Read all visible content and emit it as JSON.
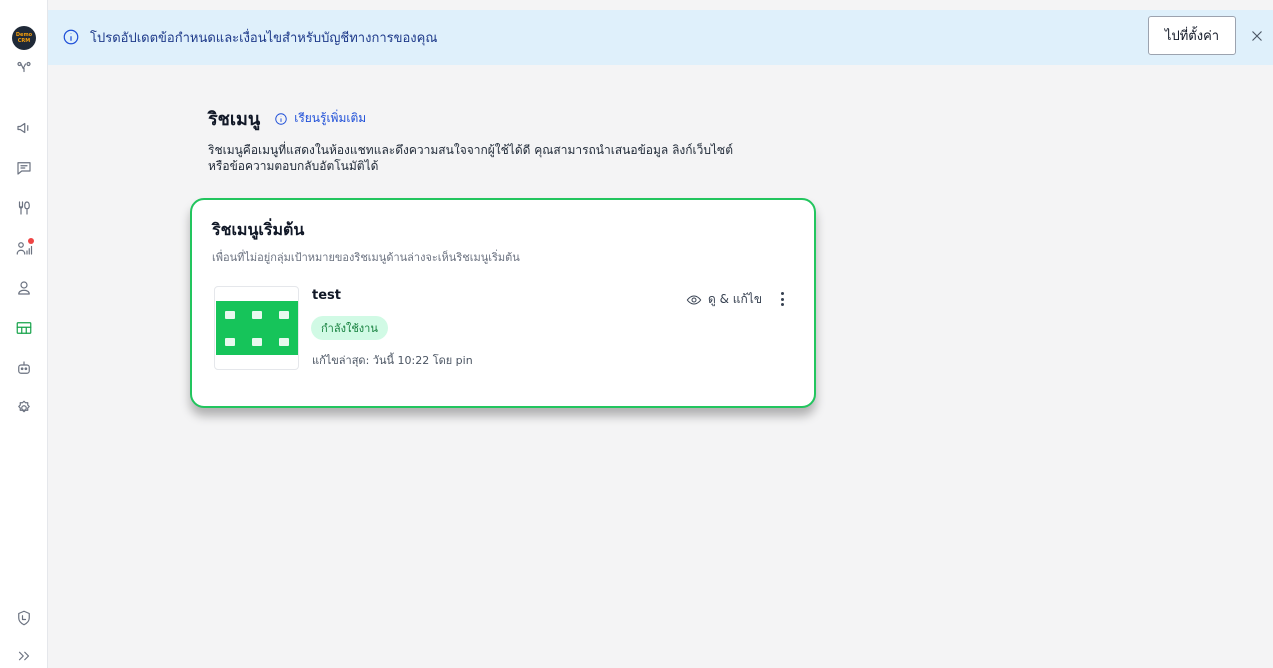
{
  "banner": {
    "message": "โปรดอัปเดตข้อกำหนดและเงื่อนไขสำหรับบัญชีทางการของคุณ",
    "button_label": "ไปที่ตั้งค่า"
  },
  "sidebar": {
    "logo_text_top": "Demo",
    "logo_text_bottom": "CRM",
    "items": [
      {
        "icon": "share-nodes-icon"
      },
      {
        "icon": "megaphone-icon"
      },
      {
        "icon": "chat-icon"
      },
      {
        "icon": "fork-spoon-icon"
      },
      {
        "icon": "user-stats-icon",
        "notification": true
      },
      {
        "icon": "user-icon"
      },
      {
        "icon": "rich-menu-icon",
        "active": true
      },
      {
        "icon": "bot-icon"
      },
      {
        "icon": "settings-icon"
      },
      {
        "icon": "shield-icon"
      },
      {
        "icon": "expand-icon"
      }
    ]
  },
  "page": {
    "title": "ริชเมนู",
    "learn_more": "เรียนรู้เพิ่มเติม",
    "description_line1": "ริชเมนูคือเมนูที่แสดงในห้องแชทและดึงความสนใจจากผู้ใช้ได้ดี คุณสามารถนำเสนอข้อมูล ลิงก์เว็บไซต์",
    "description_line2": "หรือข้อความตอบกลับอัตโนมัติได้"
  },
  "card": {
    "title": "ริชเมนูเริ่มต้น",
    "subtitle": "เพื่อนที่ไม่อยู่กลุ่มเป้าหมายของริชเมนูด้านล่างจะเห็นริชเมนูเริ่มต้น",
    "item": {
      "name": "test",
      "status": "กำลังใช้งาน",
      "last_edited": "แก้ไขล่าสุด: วันนี้ 10:22 โดย pin",
      "view_edit_label": "ดู & แก้ไข"
    }
  },
  "colors": {
    "accent": "#22c55e",
    "banner_bg": "#dff0fb",
    "link": "#1d4ed8"
  }
}
